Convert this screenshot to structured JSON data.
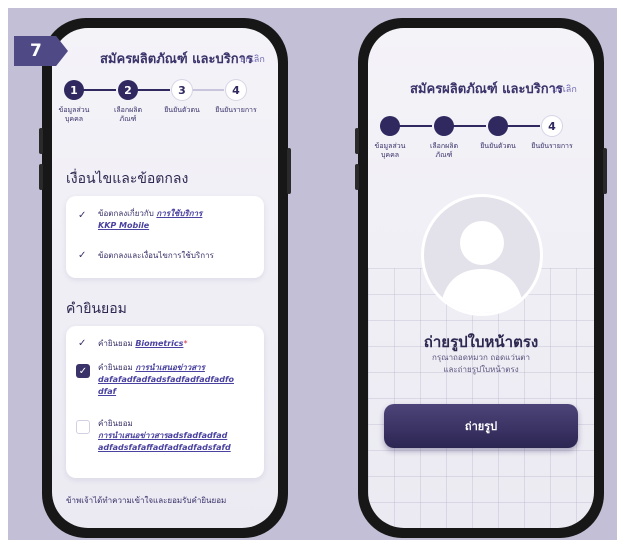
{
  "step_badge": "7",
  "left": {
    "header": {
      "title": "สมัครผลิตภัณฑ์ และบริการ",
      "cancel": "ยกเลิก"
    },
    "steps": [
      {
        "number": "1",
        "label_1": "ข้อมูลส่วน",
        "label_2": "บุคคล",
        "state": "done"
      },
      {
        "number": "2",
        "label_1": "เลือกผลิต",
        "label_2": "ภัณฑ์",
        "state": "done"
      },
      {
        "number": "3",
        "label_1": "ยืนยันตัวตน",
        "label_2": "",
        "state": "todo"
      },
      {
        "number": "4",
        "label_1": "ยืนยันรายการ",
        "label_2": "",
        "state": "todo"
      }
    ],
    "terms_title": "เงื่อนไขและข้อตกลง",
    "terms": {
      "item1_prefix": "ข้อตกลงเกี่ยวกับ",
      "item1_link_1": "การใช้บริการ",
      "item1_link_2": "KKP Mobile",
      "item2": "ข้อตกลงและเงื่อนไขการใช้บริการ"
    },
    "consent_title": "คำยินยอม",
    "consent": {
      "item1_prefix": "คำยินยอม",
      "item1_link": "Biometrics",
      "item1_req": "*",
      "item2_prefix": "คำยินยอม",
      "item2_link_1": "การนำเสนอข่าวสาร",
      "item2_link_2": "dafafadfadfadsfadfadfadfadfo",
      "item2_link_3": "dfaf",
      "item3_prefix": "คำยินยอม",
      "item3_link_1": "การนำเสนอข่าวสารadsfadfadfad",
      "item3_link_2": "adfadsfafaffadfadfadfadsfafd"
    },
    "bottom_text": "ข้าพเจ้าได้ทำความเข้าใจและยอมรับคำยินยอม"
  },
  "right": {
    "header": {
      "title": "สมัครผลิตภัณฑ์ และบริการ",
      "cancel": "ยกเลิก"
    },
    "steps": [
      {
        "number": "",
        "label_1": "ข้อมูลส่วน",
        "label_2": "บุคคล",
        "state": "done"
      },
      {
        "number": "",
        "label_1": "เลือกผลิต",
        "label_2": "ภัณฑ์",
        "state": "done"
      },
      {
        "number": "",
        "label_1": "ยืนยันตัวตน",
        "label_2": "",
        "state": "done"
      },
      {
        "number": "4",
        "label_1": "ยืนยันรายการ",
        "label_2": "",
        "state": "todo"
      }
    ],
    "photo_title": "ถ่ายรูปใบหน้าตรง",
    "photo_sub_1": "กรุณาถอดหมวก ถอดแว่นตา",
    "photo_sub_2": "และถ่ายรูปใบหน้าตรง",
    "photo_button": "ถ่ายรูป"
  },
  "colors": {
    "primary": "#2f2960",
    "accent": "#4f4a86",
    "link": "#4a42a0",
    "required": "#d62b4a"
  }
}
